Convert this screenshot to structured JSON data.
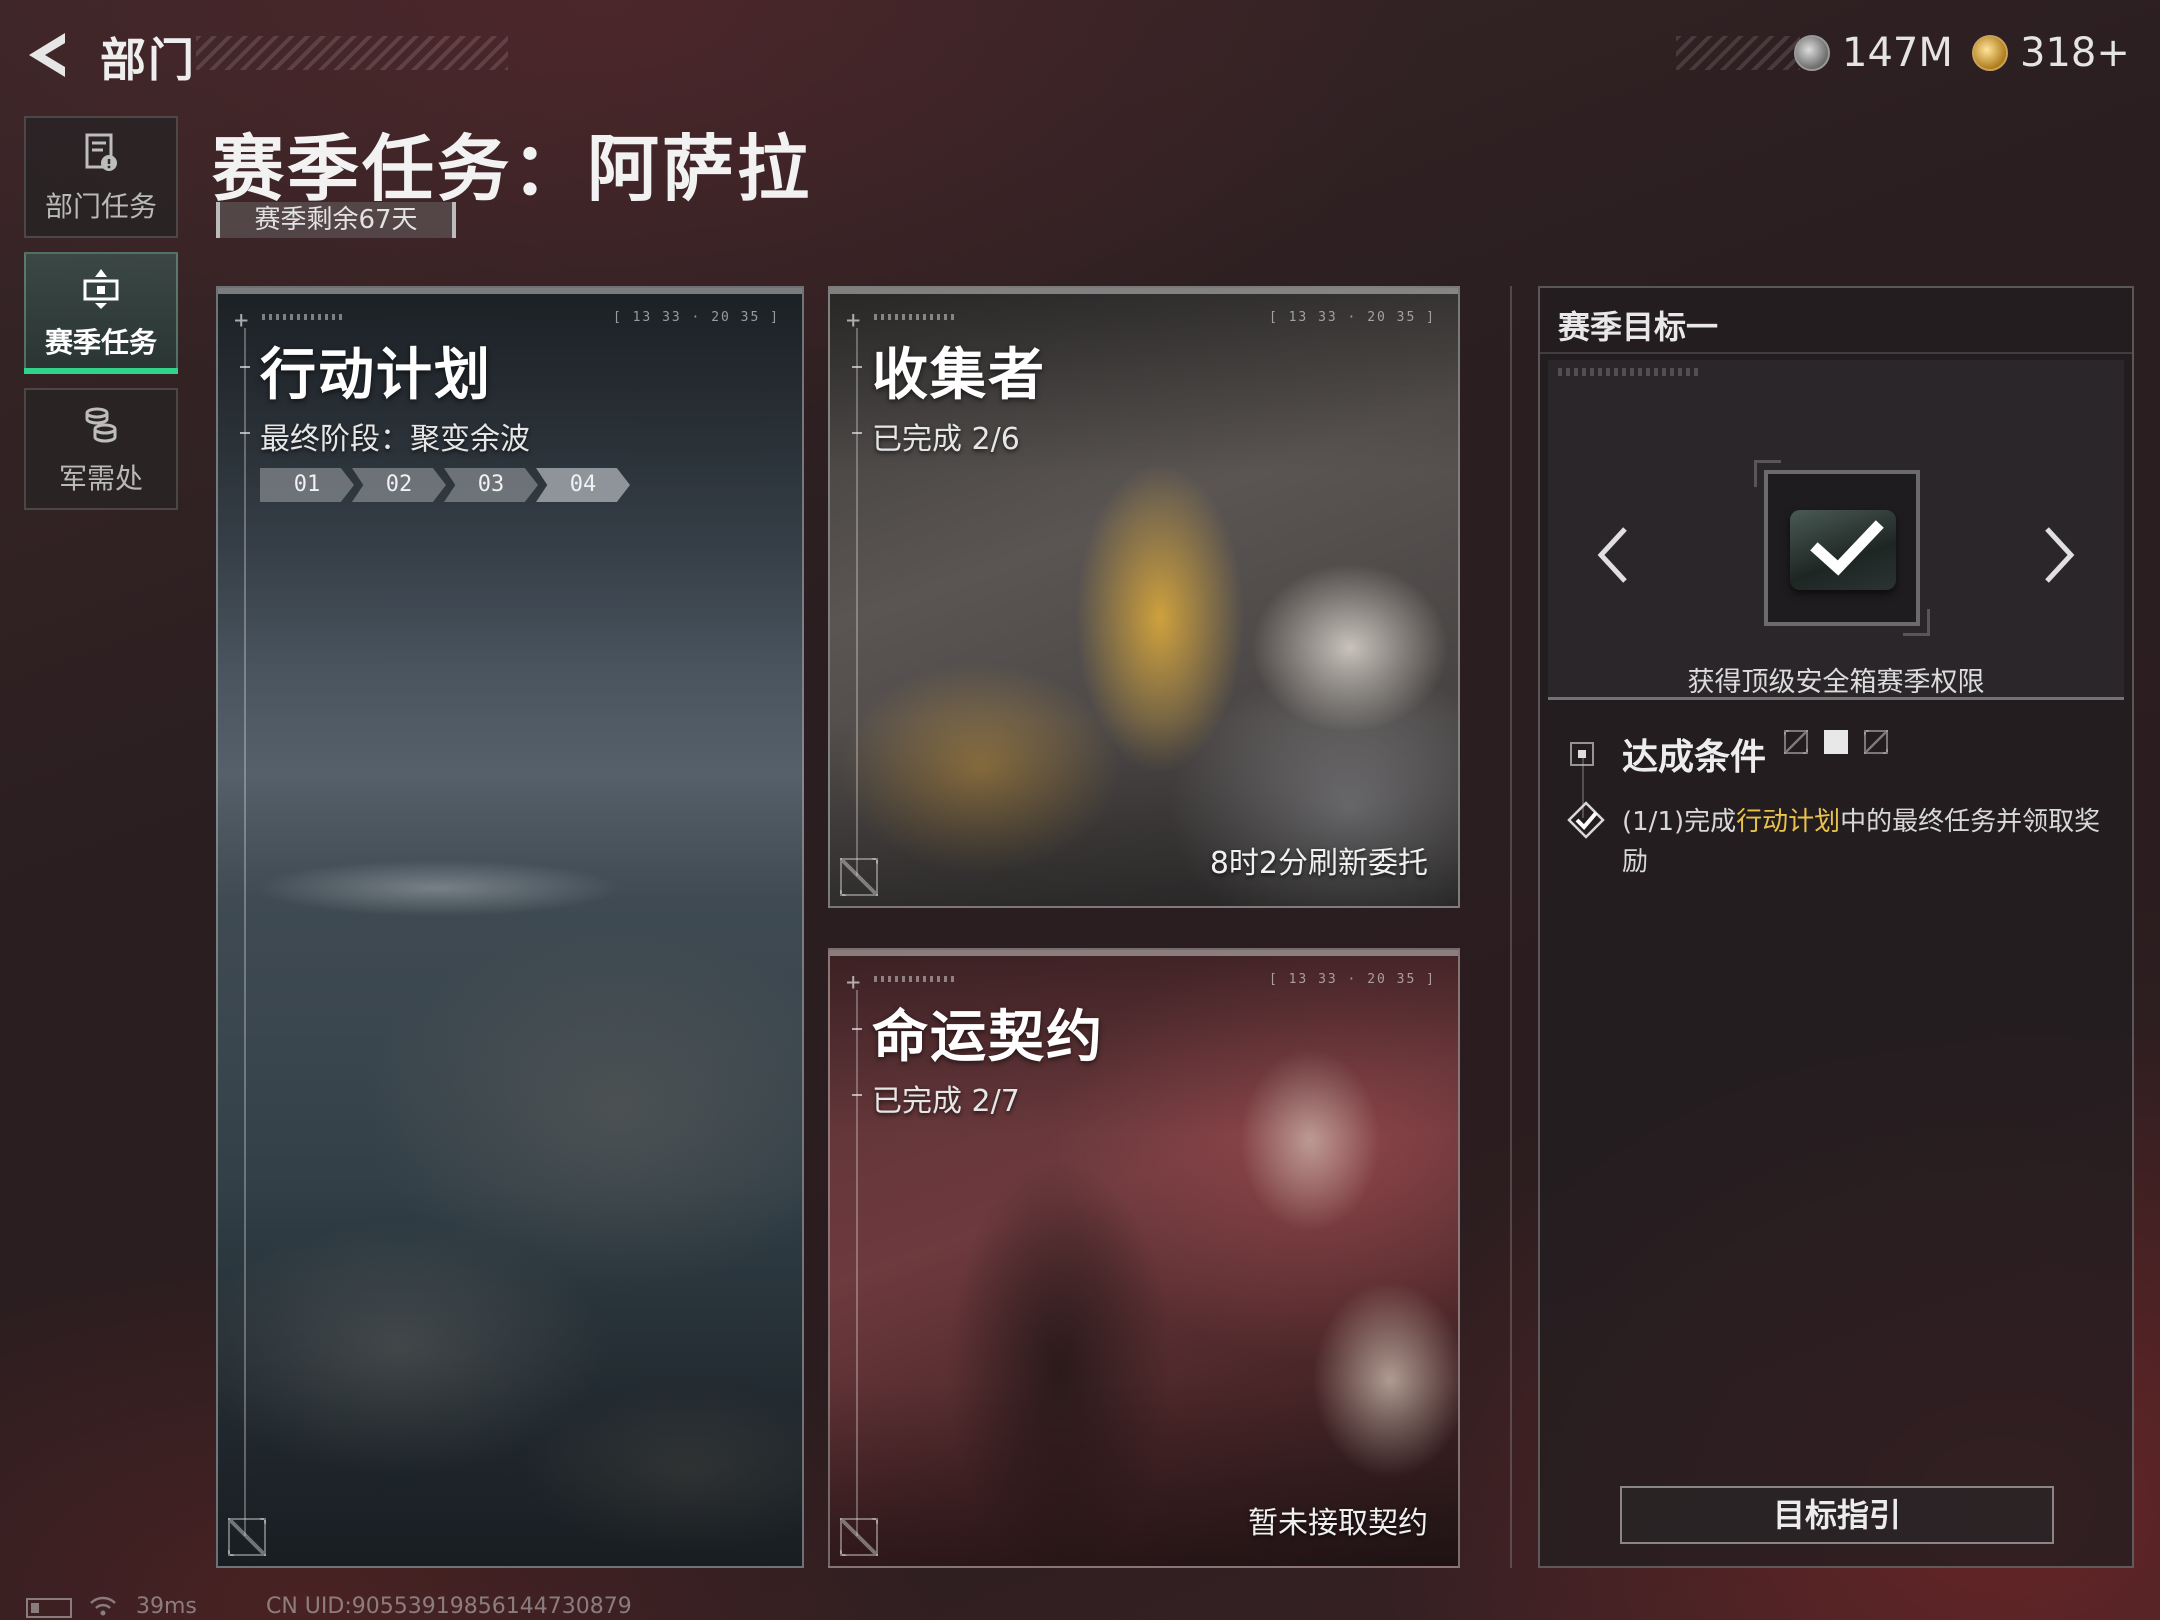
{
  "header": {
    "back_label": "部门",
    "currencies": [
      {
        "icon": "silver-coin-icon",
        "value": "147M"
      },
      {
        "icon": "gold-triangle-coin-icon",
        "value": "318+"
      }
    ]
  },
  "sidebar": {
    "items": [
      {
        "label": "部门任务",
        "icon": "department-mission-icon",
        "active": false
      },
      {
        "label": "赛季任务",
        "icon": "season-mission-icon",
        "active": true
      },
      {
        "label": "军需处",
        "icon": "quartermaster-icon",
        "active": false
      }
    ]
  },
  "page": {
    "title": "赛季任务：阿萨拉",
    "remaining": "赛季剩余67天"
  },
  "cards": {
    "operations": {
      "title": "行动计划",
      "subtitle": "最终阶段：聚变余波",
      "stages": [
        "01",
        "02",
        "03",
        "04"
      ],
      "current_stage": 4
    },
    "collector": {
      "title": "收集者",
      "progress": "已完成 2/6",
      "footer": "8时2分刷新委托"
    },
    "fate": {
      "title": "命运契约",
      "progress": "已完成 2/7",
      "footer": "暂未接取契约"
    }
  },
  "goal_panel": {
    "title": "赛季目标一",
    "reward_name": "获得顶级安全箱赛季权限",
    "reward_claimed": true,
    "page_count": 3,
    "active_page": 2,
    "conditions_title": "达成条件",
    "condition": {
      "prefix": "(1/1)完成",
      "highlight": "行动计划",
      "suffix": "中的最终任务并领取奖励",
      "done": true
    },
    "guide_button": "目标指引"
  },
  "status_bar": {
    "ping": "39ms",
    "uid": "CN UID:9055391985614473087​9"
  },
  "colors": {
    "accent_green": "#2fd38a",
    "highlight_yellow": "#e8c24a"
  }
}
